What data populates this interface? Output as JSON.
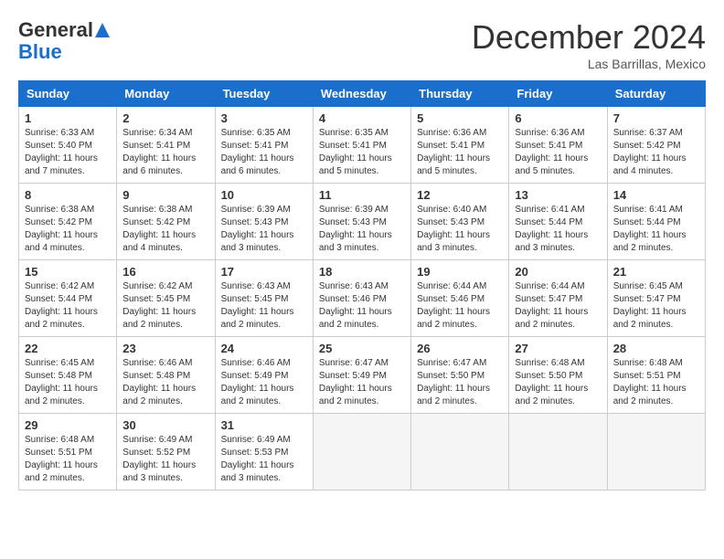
{
  "header": {
    "logo": {
      "general": "General",
      "blue": "Blue"
    },
    "title": "December 2024",
    "location": "Las Barrillas, Mexico"
  },
  "weekdays": [
    "Sunday",
    "Monday",
    "Tuesday",
    "Wednesday",
    "Thursday",
    "Friday",
    "Saturday"
  ],
  "weeks": [
    [
      {
        "day": "1",
        "sunrise": "6:33 AM",
        "sunset": "5:40 PM",
        "daylight": "11 hours and 7 minutes."
      },
      {
        "day": "2",
        "sunrise": "6:34 AM",
        "sunset": "5:41 PM",
        "daylight": "11 hours and 6 minutes."
      },
      {
        "day": "3",
        "sunrise": "6:35 AM",
        "sunset": "5:41 PM",
        "daylight": "11 hours and 6 minutes."
      },
      {
        "day": "4",
        "sunrise": "6:35 AM",
        "sunset": "5:41 PM",
        "daylight": "11 hours and 5 minutes."
      },
      {
        "day": "5",
        "sunrise": "6:36 AM",
        "sunset": "5:41 PM",
        "daylight": "11 hours and 5 minutes."
      },
      {
        "day": "6",
        "sunrise": "6:36 AM",
        "sunset": "5:41 PM",
        "daylight": "11 hours and 5 minutes."
      },
      {
        "day": "7",
        "sunrise": "6:37 AM",
        "sunset": "5:42 PM",
        "daylight": "11 hours and 4 minutes."
      }
    ],
    [
      {
        "day": "8",
        "sunrise": "6:38 AM",
        "sunset": "5:42 PM",
        "daylight": "11 hours and 4 minutes."
      },
      {
        "day": "9",
        "sunrise": "6:38 AM",
        "sunset": "5:42 PM",
        "daylight": "11 hours and 4 minutes."
      },
      {
        "day": "10",
        "sunrise": "6:39 AM",
        "sunset": "5:43 PM",
        "daylight": "11 hours and 3 minutes."
      },
      {
        "day": "11",
        "sunrise": "6:39 AM",
        "sunset": "5:43 PM",
        "daylight": "11 hours and 3 minutes."
      },
      {
        "day": "12",
        "sunrise": "6:40 AM",
        "sunset": "5:43 PM",
        "daylight": "11 hours and 3 minutes."
      },
      {
        "day": "13",
        "sunrise": "6:41 AM",
        "sunset": "5:44 PM",
        "daylight": "11 hours and 3 minutes."
      },
      {
        "day": "14",
        "sunrise": "6:41 AM",
        "sunset": "5:44 PM",
        "daylight": "11 hours and 2 minutes."
      }
    ],
    [
      {
        "day": "15",
        "sunrise": "6:42 AM",
        "sunset": "5:44 PM",
        "daylight": "11 hours and 2 minutes."
      },
      {
        "day": "16",
        "sunrise": "6:42 AM",
        "sunset": "5:45 PM",
        "daylight": "11 hours and 2 minutes."
      },
      {
        "day": "17",
        "sunrise": "6:43 AM",
        "sunset": "5:45 PM",
        "daylight": "11 hours and 2 minutes."
      },
      {
        "day": "18",
        "sunrise": "6:43 AM",
        "sunset": "5:46 PM",
        "daylight": "11 hours and 2 minutes."
      },
      {
        "day": "19",
        "sunrise": "6:44 AM",
        "sunset": "5:46 PM",
        "daylight": "11 hours and 2 minutes."
      },
      {
        "day": "20",
        "sunrise": "6:44 AM",
        "sunset": "5:47 PM",
        "daylight": "11 hours and 2 minutes."
      },
      {
        "day": "21",
        "sunrise": "6:45 AM",
        "sunset": "5:47 PM",
        "daylight": "11 hours and 2 minutes."
      }
    ],
    [
      {
        "day": "22",
        "sunrise": "6:45 AM",
        "sunset": "5:48 PM",
        "daylight": "11 hours and 2 minutes."
      },
      {
        "day": "23",
        "sunrise": "6:46 AM",
        "sunset": "5:48 PM",
        "daylight": "11 hours and 2 minutes."
      },
      {
        "day": "24",
        "sunrise": "6:46 AM",
        "sunset": "5:49 PM",
        "daylight": "11 hours and 2 minutes."
      },
      {
        "day": "25",
        "sunrise": "6:47 AM",
        "sunset": "5:49 PM",
        "daylight": "11 hours and 2 minutes."
      },
      {
        "day": "26",
        "sunrise": "6:47 AM",
        "sunset": "5:50 PM",
        "daylight": "11 hours and 2 minutes."
      },
      {
        "day": "27",
        "sunrise": "6:48 AM",
        "sunset": "5:50 PM",
        "daylight": "11 hours and 2 minutes."
      },
      {
        "day": "28",
        "sunrise": "6:48 AM",
        "sunset": "5:51 PM",
        "daylight": "11 hours and 2 minutes."
      }
    ],
    [
      {
        "day": "29",
        "sunrise": "6:48 AM",
        "sunset": "5:51 PM",
        "daylight": "11 hours and 2 minutes."
      },
      {
        "day": "30",
        "sunrise": "6:49 AM",
        "sunset": "5:52 PM",
        "daylight": "11 hours and 3 minutes."
      },
      {
        "day": "31",
        "sunrise": "6:49 AM",
        "sunset": "5:53 PM",
        "daylight": "11 hours and 3 minutes."
      },
      null,
      null,
      null,
      null
    ]
  ]
}
